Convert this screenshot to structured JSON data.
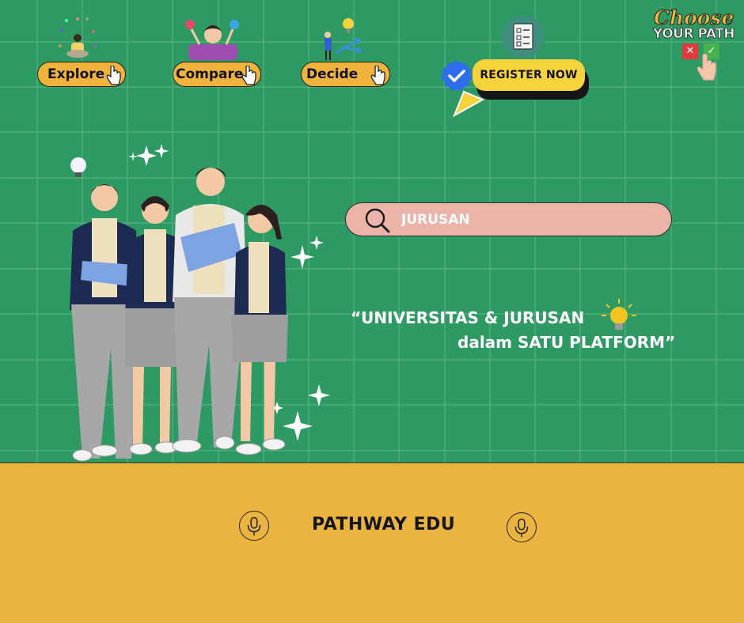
{
  "nav": {
    "explore_label": "Explore",
    "compare_label": "Compare",
    "decide_label": "Decide"
  },
  "register": {
    "label": "REGISTER NOW"
  },
  "logo": {
    "line1": "Choose",
    "line2": "YOUR PATH",
    "no_mark": "✕",
    "yes_mark": "✓"
  },
  "search": {
    "placeholder": "JURUSAN"
  },
  "tagline": {
    "line1": "“UNIVERSITAS & JURUSAN",
    "line2": "dalam SATU PLATFORM”"
  },
  "footer": {
    "brand": "PATHWAY EDU"
  },
  "colors": {
    "background": "#2e9a63",
    "footer": "#eab43f",
    "button": "#f0b43c",
    "register": "#f6d33a",
    "search": "#ecb3a8",
    "verified": "#2f6df0"
  },
  "icons": [
    "meditating-person-icon",
    "thinking-woman-icon",
    "decision-arrows-icon",
    "checklist-clipboard-icon",
    "verified-badge-icon",
    "pointer-hand-icon",
    "search-icon",
    "lightbulb-icon",
    "microphone-icon",
    "sparkle-icon"
  ]
}
